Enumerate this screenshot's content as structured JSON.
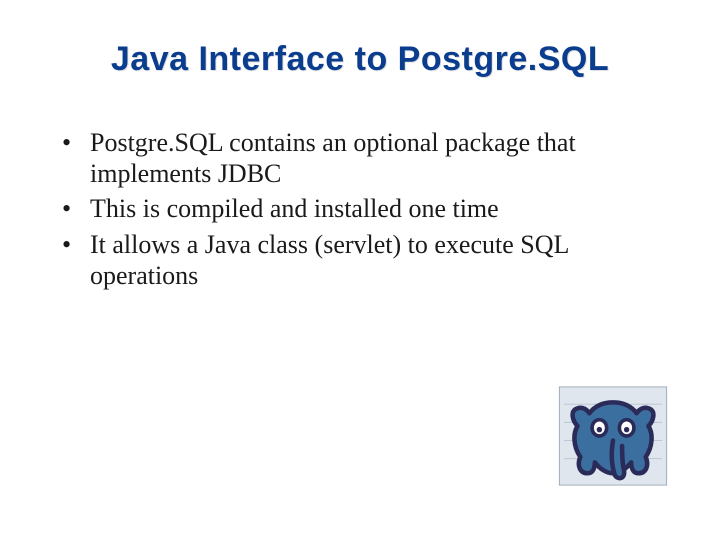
{
  "title": "Java Interface to Postgre.SQL",
  "bullets": [
    "Postgre.SQL contains an optional package that implements JDBC",
    "This is compiled and installed one time",
    "It allows a Java class (servlet) to execute SQL operations"
  ],
  "logo": {
    "name": "postgresql-logo",
    "colors": {
      "outline": "#2b2b5a",
      "body": "#3b6fa0",
      "eye_bg": "#ffffff",
      "frame": "#6a7a8a"
    }
  }
}
